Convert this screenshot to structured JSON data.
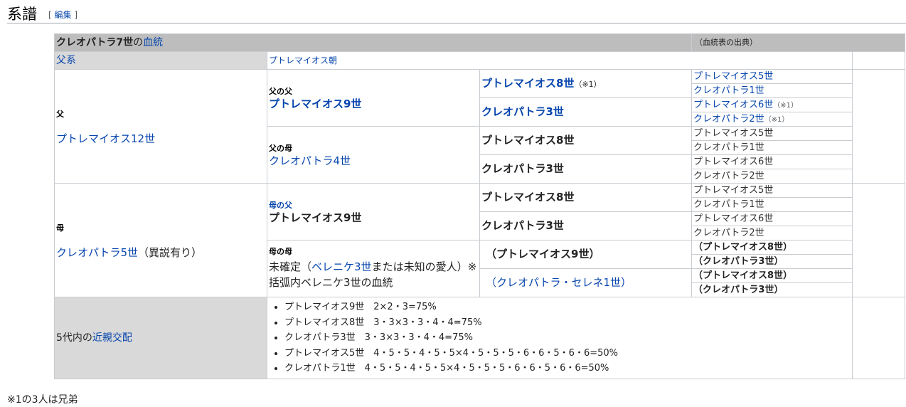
{
  "heading": {
    "title": "系譜",
    "edit_open": "[",
    "edit_label": "編集",
    "edit_close": "]"
  },
  "table": {
    "title_subject": "クレオパトラ7世",
    "title_no": "の",
    "title_link": "血統",
    "source": "（血統表の出典）",
    "lineage_label": "父系",
    "lineage_value": "プトレマイオス朝",
    "father": {
      "role": "父",
      "name": "プトレマイオス12世"
    },
    "mother": {
      "role": "母",
      "name": "クレオパトラ5世",
      "note": "（異説有り）"
    },
    "ff": {
      "role": "父の父",
      "name": "プトレマイオス9世"
    },
    "fm": {
      "role": "父の母",
      "name": "クレオパトラ4世"
    },
    "mf": {
      "role": "母の父",
      "name": "プトレマイオス9世"
    },
    "mm": {
      "role": "母の母",
      "prefix": "未確定（",
      "link": "ベレニケ3世",
      "suffix": "または未知の愛人）※",
      "line2": "括弧内ベレニケ3世の血統"
    },
    "g3": [
      {
        "name": "プトレマイオス8世",
        "note": "（※1）"
      },
      {
        "name": "クレオパトラ3世"
      },
      {
        "name": "プトレマイオス8世"
      },
      {
        "name": "クレオパトラ3世"
      },
      {
        "name": "プトレマイオス8世"
      },
      {
        "name": "クレオパトラ3世"
      },
      {
        "name": "（プトレマイオス9世）"
      },
      {
        "name": "（クレオパトラ・セレネ1世）"
      }
    ],
    "g4": [
      {
        "name": "プトレマイオス5世"
      },
      {
        "name": "クレオパトラ1世"
      },
      {
        "name": "プトレマイオス6世",
        "note": "（※1）"
      },
      {
        "name": "クレオパトラ2世",
        "note": "（※1）"
      },
      {
        "name": "プトレマイオス5世"
      },
      {
        "name": "クレオパトラ1世"
      },
      {
        "name": "プトレマイオス6世"
      },
      {
        "name": "クレオパトラ2世"
      },
      {
        "name": "プトレマイオス5世"
      },
      {
        "name": "クレオパトラ1世"
      },
      {
        "name": "プトレマイオス6世"
      },
      {
        "name": "クレオパトラ2世"
      },
      {
        "name_pre": "（",
        "name": "プトレマイオス8世",
        "name_post": "）"
      },
      {
        "name_pre": "（",
        "name": "クレオパトラ3世",
        "name_post": "）"
      },
      {
        "name_pre": "（",
        "name": "プトレマイオス8世",
        "name_post": "）"
      },
      {
        "name_pre": "（",
        "name": "クレオパトラ3世",
        "name_post": "）"
      }
    ],
    "inbreeding_prefix": "5代内の",
    "inbreeding_link": "近親交配",
    "inbreeding": [
      "プトレマイオス9世　2×2・3=75%",
      "プトレマイオス8世　3・3×3・3・4・4=75%",
      "クレオパトラ3世　3・3×3・3・4・4=75%",
      "プトレマイオス5世　4・5・5・4・5・5×4・5・5・5・6・6・5・6・6=50%",
      "クレオパトラ1世　4・5・5・4・5・5×4・5・5・5・6・6・5・6・6=50%"
    ]
  },
  "footnote": "※1の3人は兄弟"
}
